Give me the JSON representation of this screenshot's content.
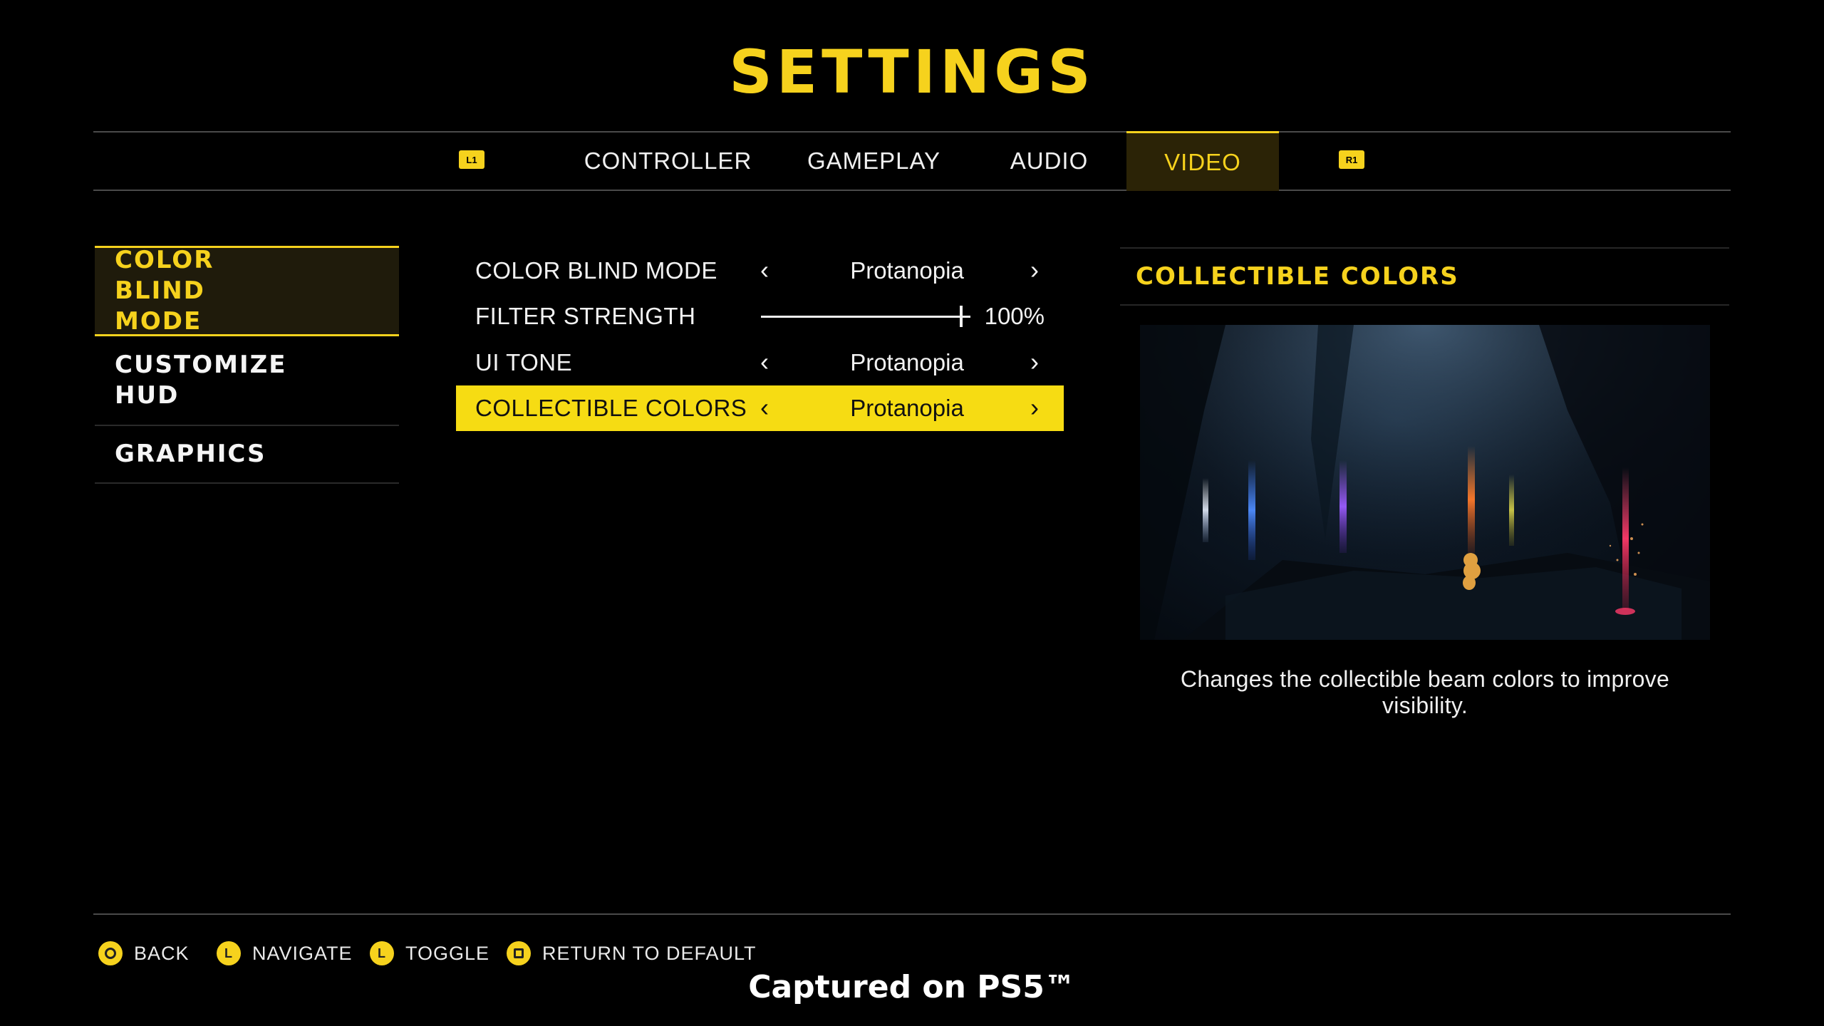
{
  "header": {
    "title": "SETTINGS"
  },
  "tabs": {
    "shoulder_left": "L1",
    "shoulder_right": "R1",
    "items": [
      {
        "label": "CONTROLLER"
      },
      {
        "label": "GAMEPLAY"
      },
      {
        "label": "AUDIO"
      },
      {
        "label": "VIDEO",
        "active": true
      }
    ]
  },
  "sidebar": {
    "items": [
      {
        "label": "COLOR BLIND MODE",
        "active": true
      },
      {
        "label": "CUSTOMIZE HUD"
      },
      {
        "label": "GRAPHICS"
      }
    ]
  },
  "options": [
    {
      "label": "COLOR BLIND MODE",
      "value": "Protanopia",
      "type": "selector"
    },
    {
      "label": "FILTER STRENGTH",
      "value": "100%",
      "type": "slider",
      "level": 1.0
    },
    {
      "label": "UI TONE",
      "value": "Protanopia",
      "type": "selector"
    },
    {
      "label": "COLLECTIBLE COLORS",
      "value": "Protanopia",
      "type": "selector",
      "selected": true
    }
  ],
  "preview": {
    "heading": "COLLECTIBLE COLORS",
    "description": "Changes the collectible beam colors to improve visibility."
  },
  "footer": {
    "hints": [
      {
        "icon": "circle-button-icon",
        "label": "BACK"
      },
      {
        "icon": "left-stick-icon",
        "glyph": "L",
        "label": "NAVIGATE"
      },
      {
        "icon": "left-stick-icon",
        "glyph": "L",
        "label": "TOGGLE"
      },
      {
        "icon": "square-button-icon",
        "label": "RETURN TO DEFAULT"
      }
    ]
  },
  "watermark": "Captured on PS5™",
  "colors": {
    "accent": "#f6d21d",
    "background": "#000000"
  }
}
